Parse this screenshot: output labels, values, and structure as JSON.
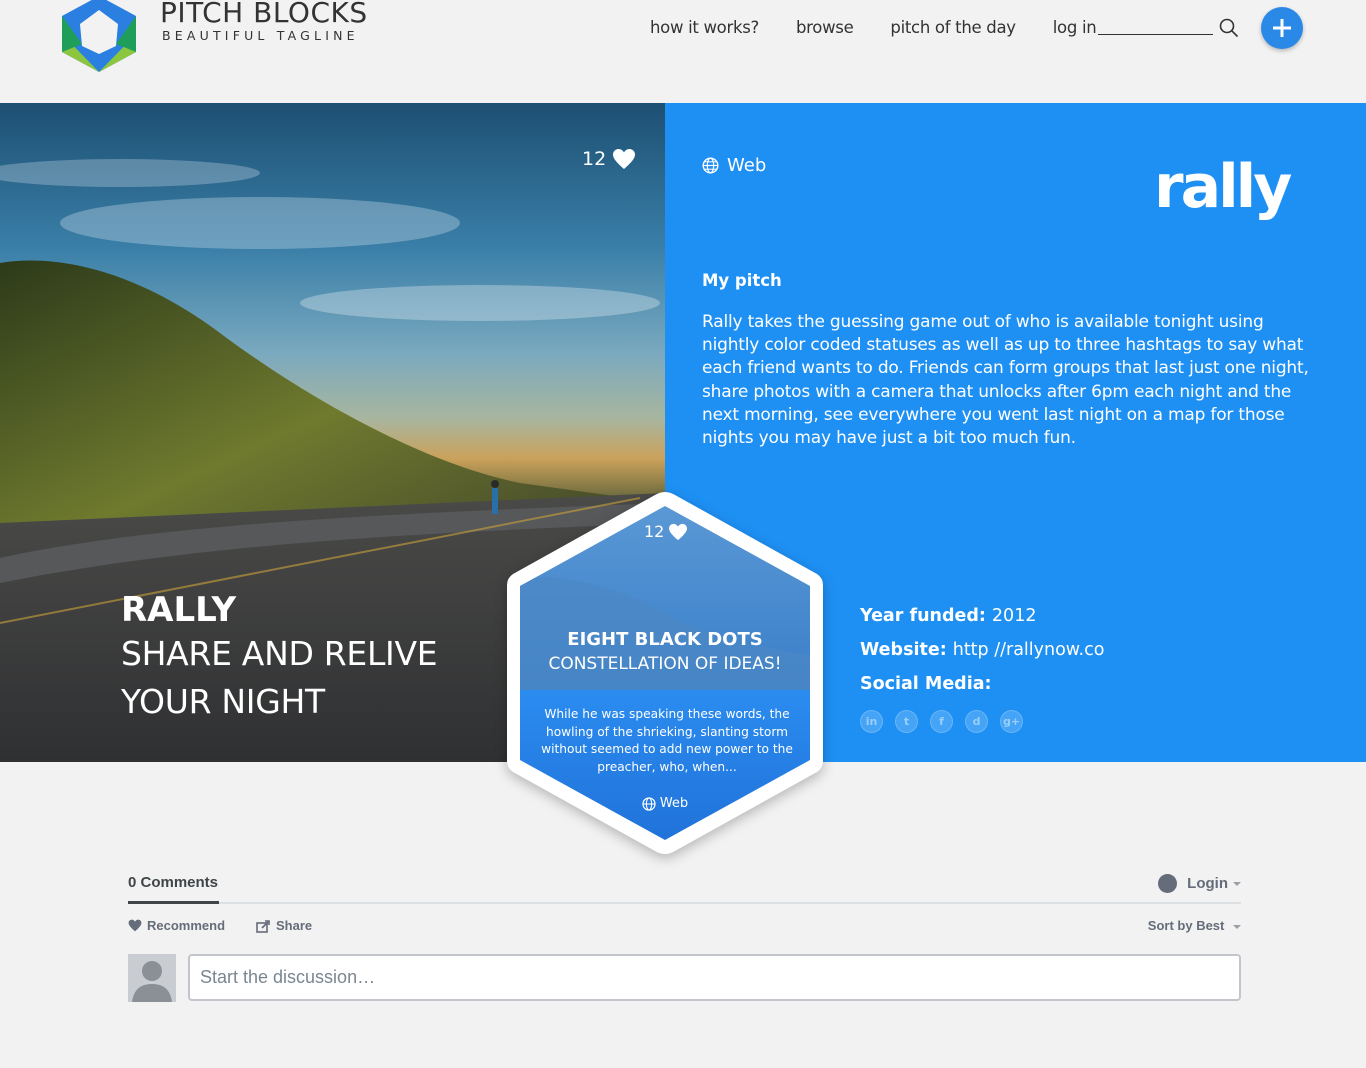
{
  "header": {
    "brand_name": "PITCH BLOCKS",
    "tagline": "BEAUTIFUL TAGLINE",
    "nav": [
      "how it works?",
      "browse",
      "pitch of the day",
      "log in"
    ],
    "search_placeholder": ""
  },
  "hero": {
    "likes": "12",
    "title": "RALLY",
    "subtitle_line1": "SHARE AND RELIVE",
    "subtitle_line2": "YOUR NIGHT"
  },
  "detail": {
    "category": "Web",
    "logo_text": "rally",
    "pitch_heading": "My pitch",
    "pitch_text": "Rally takes the guessing game out of who is available tonight using nightly color coded statuses as well as up to three hashtags to say what each friend wants to do. Friends can form groups that last just one night, share photos with a camera that unlocks after 6pm each night and the next morning, see everywhere you went last night on a map for those nights you may have just a bit too much fun.",
    "year_label": "Year funded:",
    "year_value": "2012",
    "website_label": "Website:",
    "website_value": "http //rallynow.co",
    "social_label": "Social Media:",
    "socials": [
      "in",
      "t",
      "f",
      "d",
      "g+"
    ]
  },
  "card": {
    "likes": "12",
    "title": "EIGHT BLACK DOTS",
    "subtitle": "CONSTELLATION OF IDEAS!",
    "description": "While he was speaking these words, the howling of the shrieking, slanting storm without seemed to add new power to the preacher, who, when...",
    "category": "Web"
  },
  "comments": {
    "count": "0 Comments",
    "login": "Login",
    "recommend": "Recommend",
    "share": "Share",
    "sort": "Sort by Best",
    "placeholder": "Start the discussion…"
  },
  "colors": {
    "accent_blue": "#1e90f4",
    "add_button": "#2a89e6"
  }
}
